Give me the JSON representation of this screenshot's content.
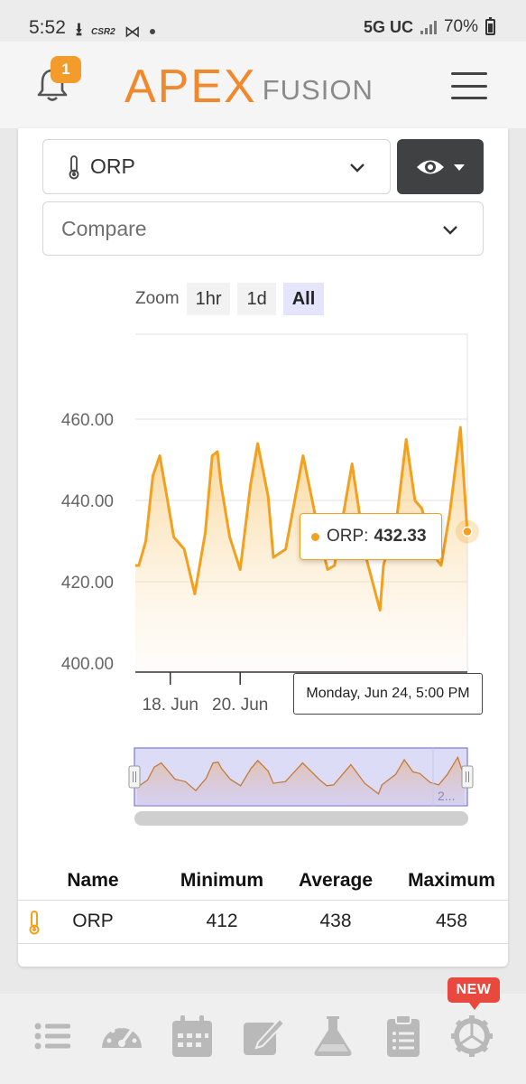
{
  "status_bar": {
    "time": "5:52",
    "carrier_icon_text": "CSR2",
    "network": "5G UC",
    "battery": "70%"
  },
  "header": {
    "notification_count": "1",
    "logo_main": "APEX",
    "logo_sub": "FUSION"
  },
  "controls": {
    "probe_select_value": "ORP",
    "compare_placeholder": "Compare",
    "zoom_label": "Zoom",
    "zoom_options": [
      "1hr",
      "1d",
      "All"
    ],
    "zoom_selected": "All"
  },
  "chart_data": {
    "type": "area",
    "series": [
      {
        "name": "ORP",
        "x_days": [
          17.0,
          17.1,
          17.3,
          17.5,
          17.7,
          17.9,
          18.1,
          18.4,
          18.7,
          19.0,
          19.2,
          19.35,
          19.45,
          19.7,
          20.0,
          20.3,
          20.5,
          20.8,
          20.95,
          21.3,
          21.8,
          22.3,
          22.5,
          22.7,
          23.2,
          23.6,
          24.0,
          24.1,
          24.5,
          24.75,
          25.0,
          25.2,
          25.5,
          25.75,
          26.0,
          26.3,
          26.5
        ],
        "values": [
          424,
          424,
          430,
          446,
          451,
          441,
          431,
          428,
          417,
          432,
          451,
          452,
          444,
          431,
          423,
          444,
          454,
          441,
          426,
          428,
          451,
          430,
          423,
          424,
          449,
          426,
          413,
          424,
          437,
          455,
          440,
          438,
          427,
          424,
          437,
          458,
          432
        ]
      }
    ],
    "x_ticks": [
      "18. Jun",
      "20. Jun"
    ],
    "y_ticks": [
      "400.00",
      "420.00",
      "440.00",
      "460.00"
    ],
    "ylim": [
      400,
      460
    ],
    "tooltip": {
      "series": "ORP:",
      "value": "432.33",
      "date": "Monday, Jun 24, 5:00 PM"
    },
    "navigator_label": "2...",
    "grid": true
  },
  "stats_table": {
    "headers": [
      "Name",
      "Minimum",
      "Average",
      "Maximum"
    ],
    "rows": [
      {
        "name": "ORP",
        "min": "412",
        "avg": "438",
        "max": "458"
      }
    ]
  },
  "bottom_nav": {
    "items": [
      "list-icon",
      "dashboard-icon",
      "calendar-icon",
      "edit-icon",
      "flask-icon",
      "clipboard-icon",
      "gear-icon"
    ],
    "new_badge": "NEW"
  },
  "colors": {
    "brand_orange": "#f0892e",
    "series_orange": "#f3a01e",
    "badge_red": "#e8483e",
    "zoom_active": "#e4e4fb"
  }
}
